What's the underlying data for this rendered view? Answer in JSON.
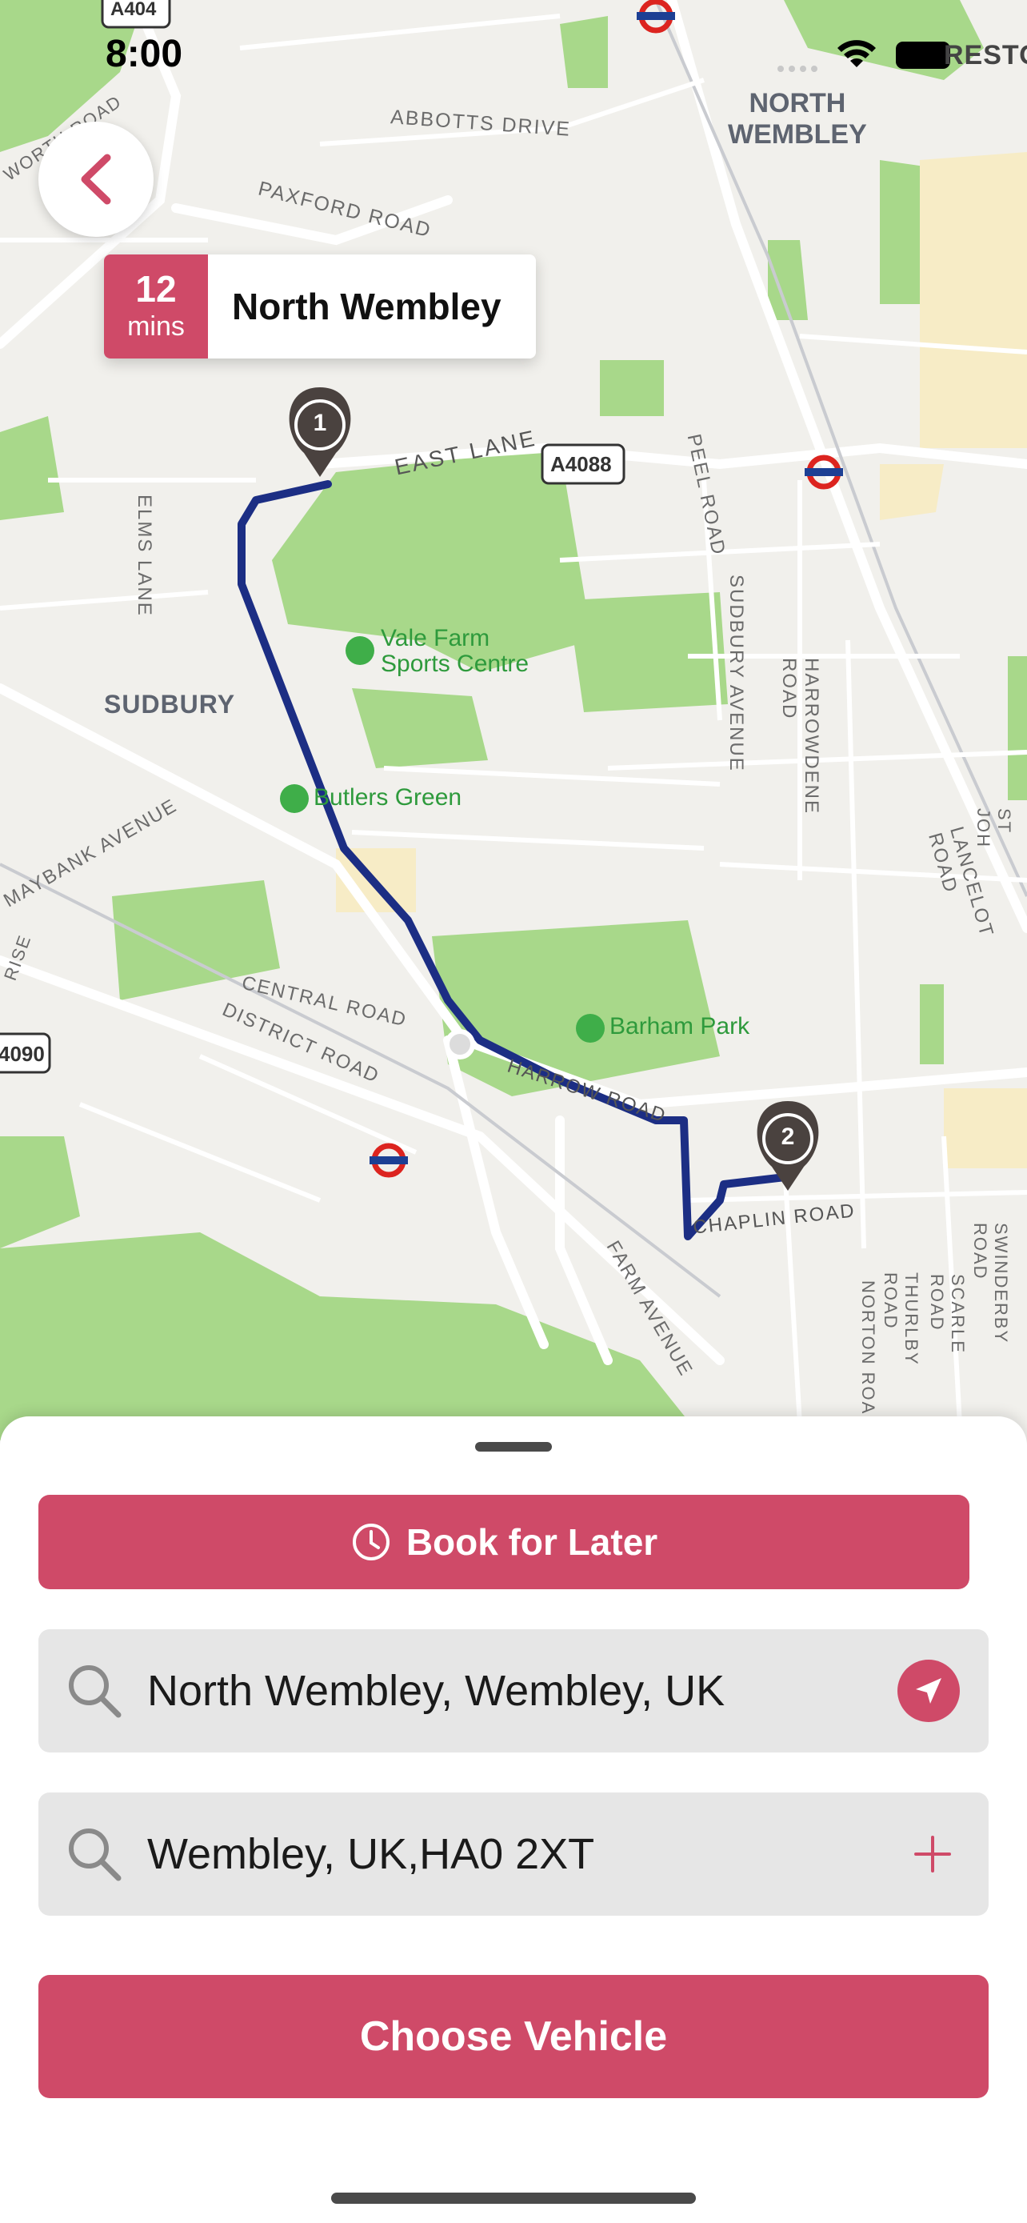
{
  "status": {
    "time": "8:00",
    "carrier": "RESTO"
  },
  "eta": {
    "minutes": "12",
    "unit": "mins",
    "place": "North Wembley"
  },
  "map": {
    "labels": {
      "north_wembley": [
        "NORTH",
        "WEMBLEY"
      ],
      "abbotts_drive": "ABBOTTS DRIVE",
      "paxford_road": "PAXFORD ROAD",
      "east_lane": "EAST LANE",
      "a4088": "A4088",
      "a404": "A404",
      "a4090": "4090",
      "peel_road": "PEEL ROAD",
      "elms_lane": "ELMS LANE",
      "sudbury": "SUDBURY",
      "sudbury_avenue": "SUDBURY AVENUE",
      "harrowdene_road": "HARROWDENE ROAD",
      "lancelot_road": "LANCELOT ROAD",
      "maybank_avenue": "MAYBANK AVENUE",
      "central_road": "CENTRAL ROAD",
      "district_road": "DISTRICT ROAD",
      "harrow_road": "HARROW ROAD",
      "chaplin_road": "CHAPLIN ROAD",
      "farm_avenue": "FARM AVENUE",
      "norton_road": "NORTON ROA",
      "thurlby_road": "THURLBY ROAD",
      "scarle_road": "SCARLE ROAD",
      "swinderby_road": "SWINDERBY ROAD",
      "st_john": "ST JOH",
      "worth_road": "WORTH ROAD",
      "rise": "RISE",
      "vale_farm": [
        "Vale Farm",
        "Sports Centre"
      ],
      "butlers_green": "Butlers Green",
      "barham_park": "Barham Park"
    },
    "pins": {
      "start": "1",
      "end": "2"
    },
    "route_color": "#1c2e84",
    "park_color": "#a8d88a"
  },
  "booking": {
    "book_later_label": "Book for Later"
  },
  "pickup": {
    "value": "North Wembley, Wembley, UK"
  },
  "destination": {
    "value": "Wembley, UK,HA0 2XT"
  },
  "actions": {
    "choose_vehicle_label": "Choose Vehicle"
  },
  "colors": {
    "accent": "#cf4a68",
    "field_bg": "#e6e6e6"
  },
  "icons": {
    "back": "chevron-left-icon",
    "clock": "clock-icon",
    "search": "search-icon",
    "locate": "location-arrow-icon",
    "add": "plus-icon"
  }
}
